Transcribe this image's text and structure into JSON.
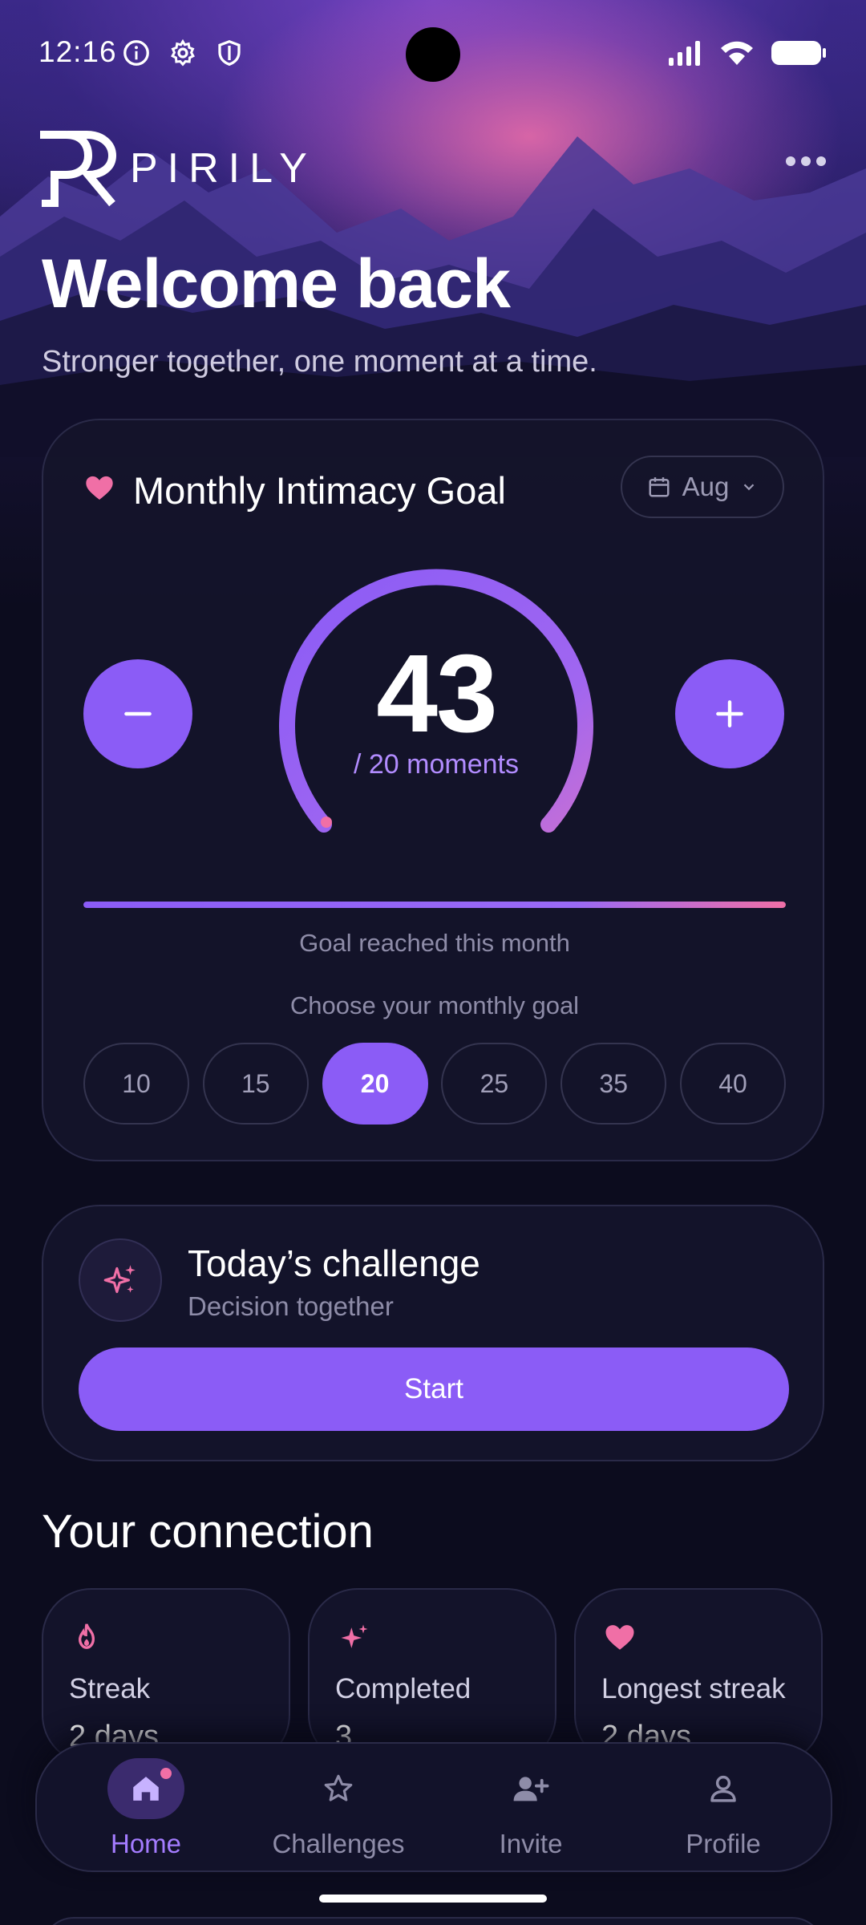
{
  "status_bar": {
    "time": "12:16",
    "left_icons": [
      "info-icon",
      "gear-icon",
      "shield-icon"
    ],
    "right_icons": [
      "signal-icon",
      "wifi-icon",
      "battery-icon"
    ]
  },
  "header": {
    "brand": "PIRILY",
    "more_icon": "more-horizontal-icon"
  },
  "welcome": {
    "title": "Welcome back",
    "subtitle": "Stronger together, one moment at a time."
  },
  "goal": {
    "title": "Monthly Intimacy Goal",
    "month": "Aug",
    "count": "43",
    "caption": "/ 20 moments",
    "progress_fraction": 1.0,
    "status": "Goal reached this month",
    "choose_label": "Choose your monthly goal",
    "options": [
      "10",
      "15",
      "20",
      "25",
      "35",
      "40"
    ],
    "selected": "20"
  },
  "challenge": {
    "title": "Today’s challenge",
    "subtitle": "Decision together",
    "start_label": "Start"
  },
  "connection": {
    "title": "Your connection",
    "stats": [
      {
        "label": "Streak",
        "value": "2 days",
        "icon": "flame-icon"
      },
      {
        "label": "Completed",
        "value": "3",
        "icon": "sparkles-icon"
      },
      {
        "label": "Longest streak",
        "value": "2 days",
        "icon": "heart-icon"
      }
    ]
  },
  "nav": {
    "items": [
      {
        "label": "Home",
        "icon": "home-icon",
        "active": true
      },
      {
        "label": "Challenges",
        "icon": "star-icon",
        "active": false
      },
      {
        "label": "Invite",
        "icon": "add-user-icon",
        "active": false
      },
      {
        "label": "Profile",
        "icon": "user-icon",
        "active": false
      }
    ]
  },
  "colors": {
    "accent": "#8b5cf6",
    "pink": "#f06fa6",
    "background": "#0c0c1e",
    "card": "#13132a"
  }
}
